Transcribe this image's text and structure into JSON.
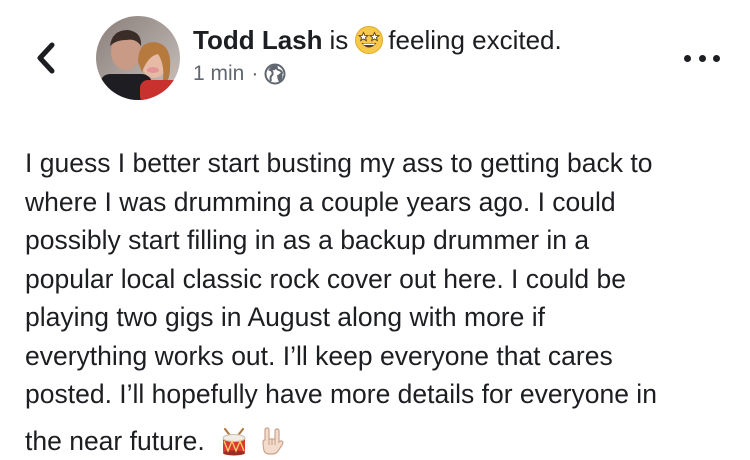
{
  "post": {
    "author": "Todd Lash",
    "title_suffix_before_icon": "is",
    "feeling": "feeling excited.",
    "feeling_icon": "star-struck-emoji-icon",
    "timestamp": "1 min",
    "separator": "·",
    "audience_icon": "globe-icon",
    "body_lines": [
      "I guess I better start busting my ass to getting back to",
      "where I was drumming a couple years ago. I could",
      "possibly start filling in as a backup drummer in a",
      "popular local classic rock cover out here. I could be",
      "playing two gigs in August along with more if",
      "everything works out. I’ll keep everyone that cares",
      "posted. I’ll hopefully have more details for everyone in",
      "the near future."
    ],
    "trailing_emojis": [
      "drum-emoji-icon",
      "rock-on-hand-emoji-icon"
    ]
  },
  "nav": {
    "back_icon": "chevron-left-icon",
    "more_icon": "more-options-icon"
  },
  "colors": {
    "text": "#1c1e21",
    "secondary_text": "#606770",
    "background": "#ffffff"
  }
}
